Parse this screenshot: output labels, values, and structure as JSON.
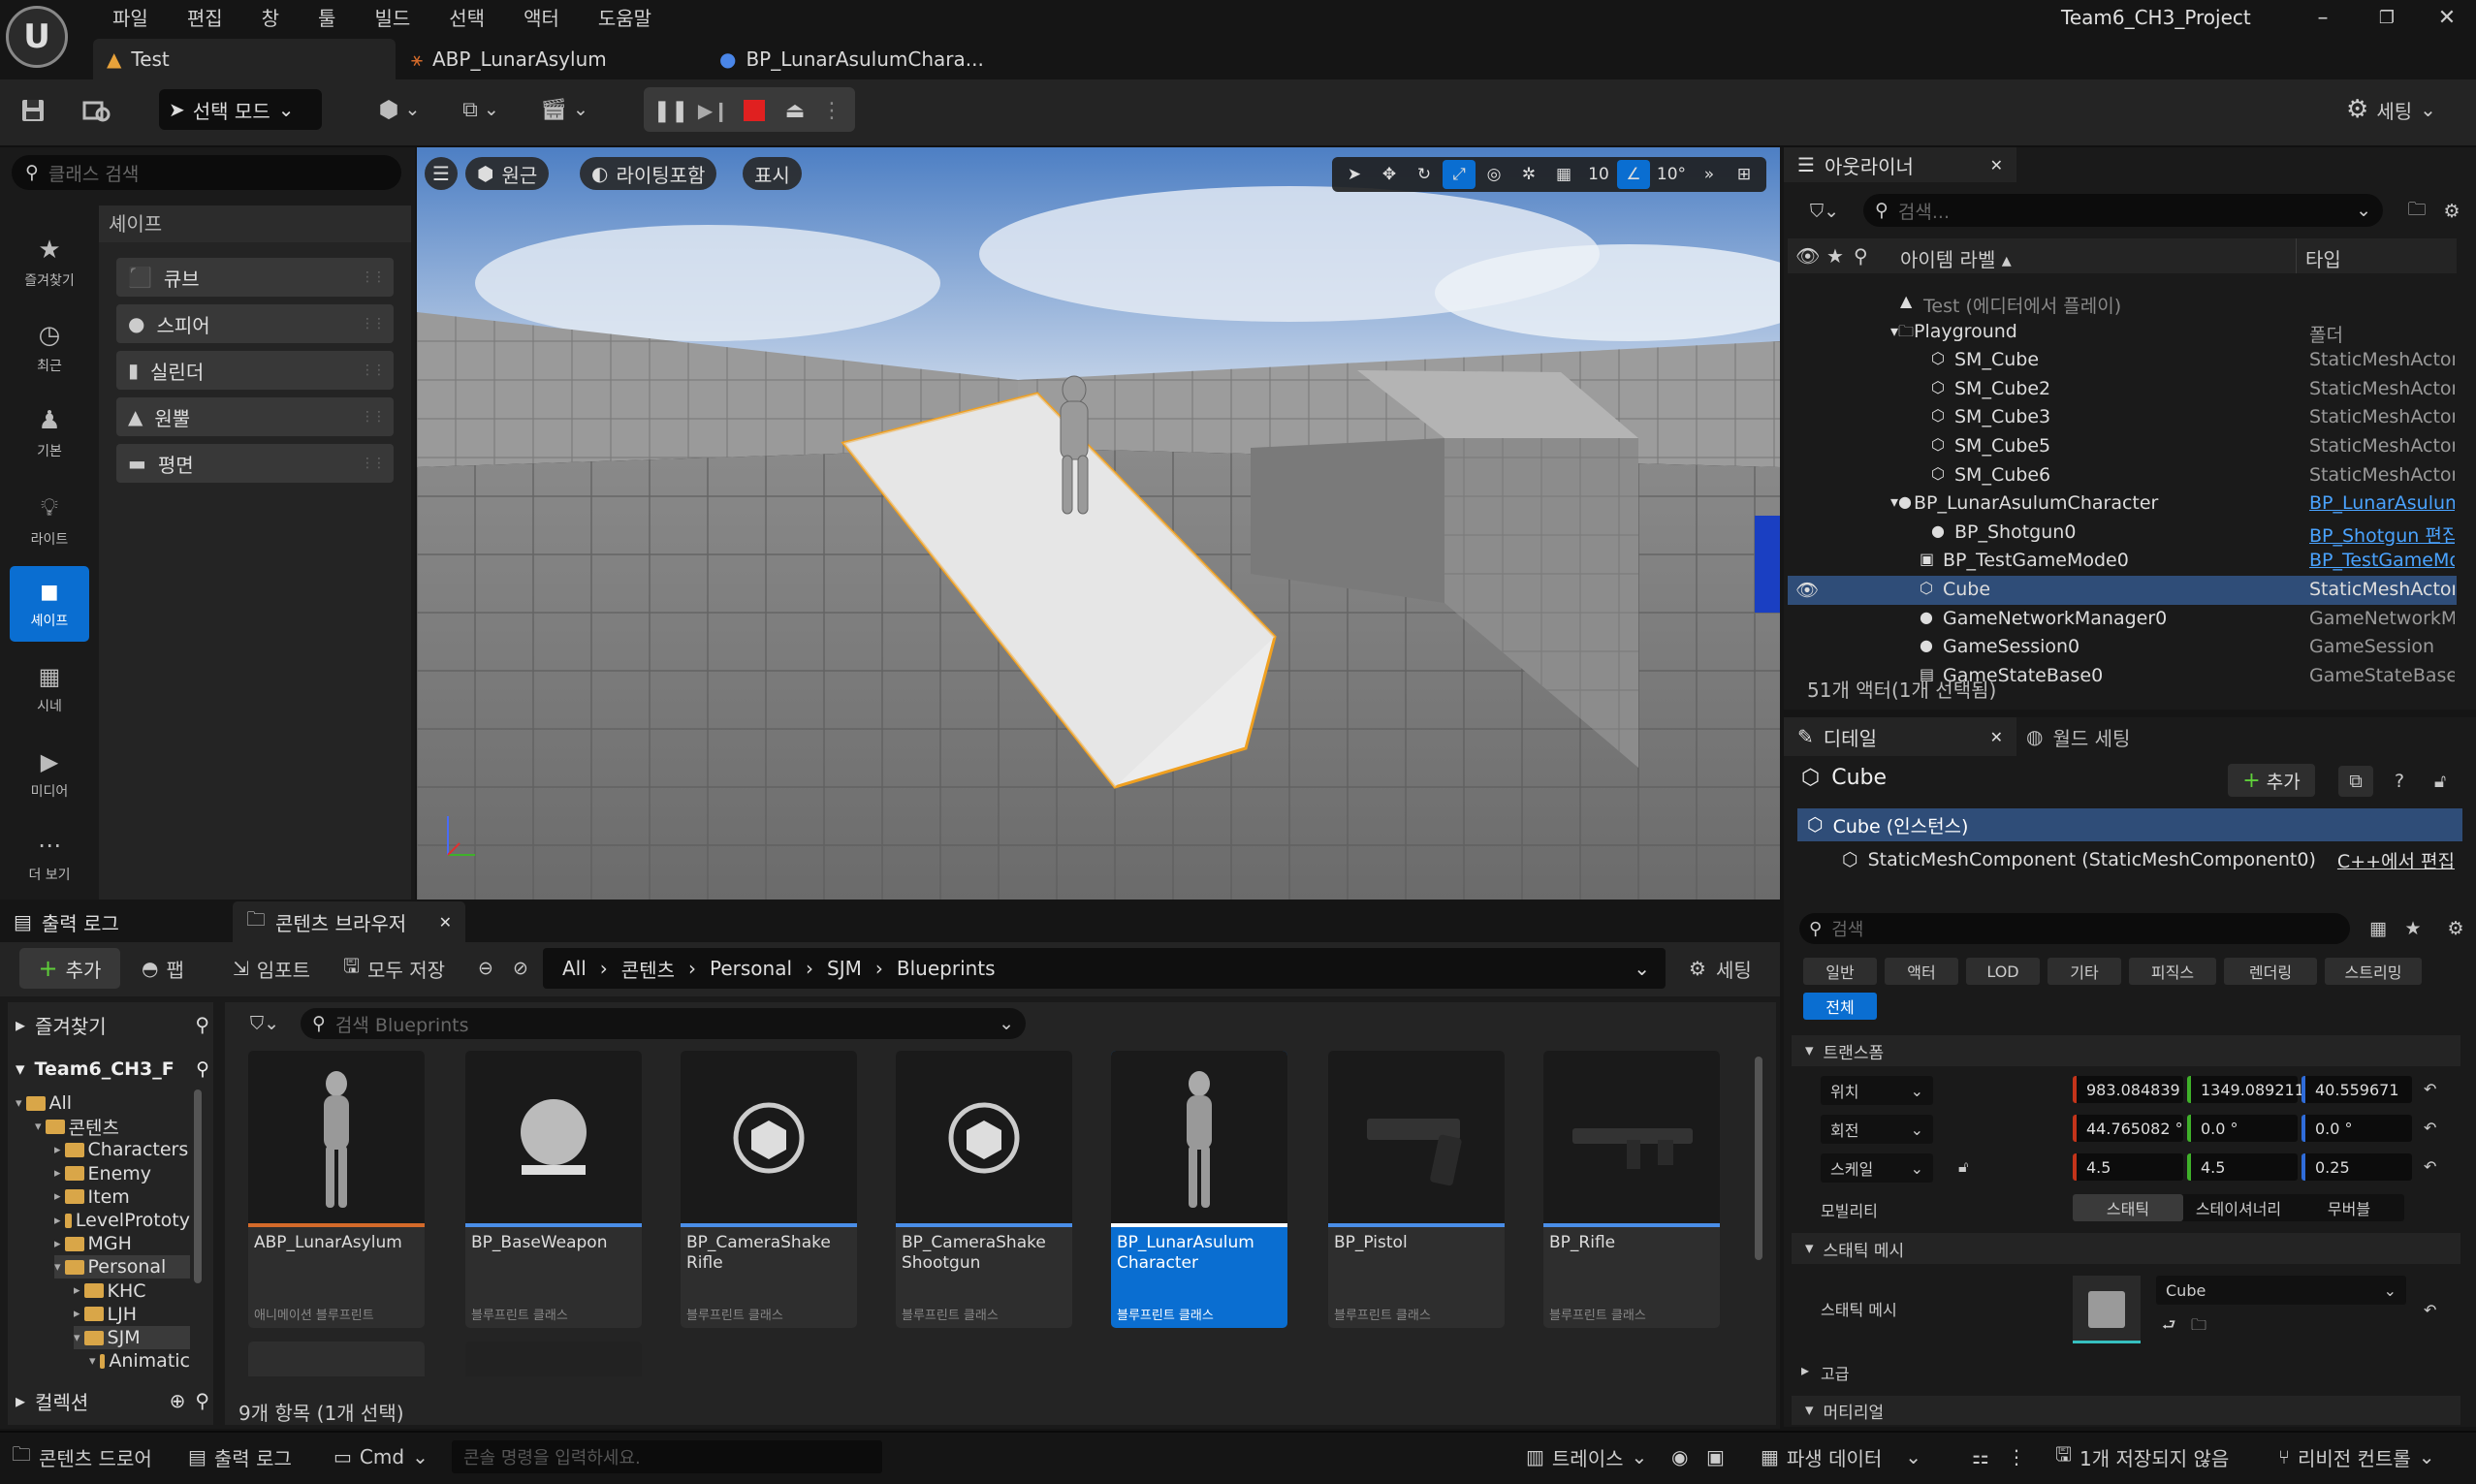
{
  "menu": [
    "파일",
    "편집",
    "창",
    "툴",
    "빌드",
    "선택",
    "액터",
    "도움말"
  ],
  "tabs": {
    "level": "Test",
    "anim": "ABP_LunarAsylum",
    "char": "BP_LunarAsulumChara..."
  },
  "project_title": "Team6_CH3_Project",
  "toolbar": {
    "mode": "선택 모드",
    "settings": "세팅"
  },
  "place_actors": {
    "search_placeholder": "클래스 검색",
    "categories": [
      "즐겨찾기",
      "최근",
      "기본",
      "라이트",
      "셰이프",
      "시네",
      "미디어",
      "더 보기"
    ],
    "active_category": "셰이프",
    "header": "셰이프",
    "shapes": [
      "큐브",
      "스피어",
      "실린더",
      "원뿔",
      "평면"
    ]
  },
  "viewport": {
    "view_mode": "원근",
    "lighting": "라이팅포함",
    "show": "표시",
    "grid_snap": "10",
    "rot_snap": "10°"
  },
  "outliner": {
    "title": "아웃라이너",
    "search_placeholder": "검색...",
    "col_label": "아이템 라벨 ▴",
    "col_type": "타입",
    "rows": [
      {
        "name": "Test (에디터에서 플레이)",
        "type": ""
      },
      {
        "name": "Playground",
        "type": "폴더"
      },
      {
        "name": "SM_Cube",
        "type": "StaticMeshActor"
      },
      {
        "name": "SM_Cube2",
        "type": "StaticMeshActor"
      },
      {
        "name": "SM_Cube3",
        "type": "StaticMeshActor"
      },
      {
        "name": "SM_Cube5",
        "type": "StaticMeshActor"
      },
      {
        "name": "SM_Cube6",
        "type": "StaticMeshActor"
      },
      {
        "name": "BP_LunarAsulumCharacter",
        "type": "BP_LunarAsulum"
      },
      {
        "name": "BP_Shotgun0",
        "type": "BP_Shotgun 편집"
      },
      {
        "name": "BP_TestGameMode0",
        "type": "BP_TestGameMo"
      },
      {
        "name": "Cube",
        "type": "StaticMeshActor"
      },
      {
        "name": "GameNetworkManager0",
        "type": "GameNetworkMa"
      },
      {
        "name": "GameSession0",
        "type": "GameSession"
      },
      {
        "name": "GameStateBase0",
        "type": "GameStateBase"
      }
    ],
    "status": "51개 액터(1개 선택됨)"
  },
  "details": {
    "title": "디테일",
    "world_tab": "월드 세팅",
    "actor_name": "Cube",
    "add_label": "추가",
    "instance": "Cube (인스턴스)",
    "component": "StaticMeshComponent (StaticMeshComponent0)",
    "cpp_edit": "C++에서 편집",
    "search_placeholder": "검색",
    "filters": [
      "일반",
      "액터",
      "LOD",
      "기타",
      "피직스",
      "렌더링",
      "스트리밍"
    ],
    "filter_all": "전체",
    "transform_header": "트랜스폼",
    "location": {
      "label": "위치",
      "x": "983.084839",
      "y": "1349.089211",
      "z": "40.559671"
    },
    "rotation": {
      "label": "회전",
      "x": "44.765082 °",
      "y": "0.0 °",
      "z": "0.0 °"
    },
    "scale": {
      "label": "스케일",
      "x": "4.5",
      "y": "4.5",
      "z": "0.25"
    },
    "mobility": {
      "label": "모빌리티",
      "options": [
        "스태틱",
        "스테이셔너리",
        "무버블"
      ]
    },
    "static_mesh_header": "스태틱 메시",
    "static_mesh_label": "스태틱 메시",
    "static_mesh_value": "Cube",
    "advanced": "고급",
    "materials_header": "머티리얼"
  },
  "content_browser": {
    "output_tab": "출력 로그",
    "cb_tab": "콘텐츠 브라우저",
    "add": "추가",
    "fab": "팹",
    "import": "임포트",
    "save_all": "모두 저장",
    "path": [
      "All",
      "콘텐츠",
      "Personal",
      "SJM",
      "Blueprints"
    ],
    "settings": "세팅",
    "favorites": "즐겨찾기",
    "project": "Team6_CH3_F",
    "tree": [
      "All",
      "콘텐츠",
      "Characters",
      "Enemy",
      "Item",
      "LevelPrototy",
      "MGH",
      "Personal",
      "KHC",
      "LJH",
      "SJM",
      "Animatic"
    ],
    "collections": "컬렉션",
    "search_placeholder": "검색 Blueprints",
    "assets": [
      {
        "name": "ABP_LunarAsylum",
        "type": "애니메이션 블루프린트"
      },
      {
        "name": "BP_BaseWeapon",
        "type": "블루프린트 클래스"
      },
      {
        "name": "BP_CameraShake Rifle",
        "type": "블루프린트 클래스"
      },
      {
        "name": "BP_CameraShake Shootgun",
        "type": "블루프린트 클래스"
      },
      {
        "name": "BP_LunarAsulum Character",
        "type": "블루프린트 클래스"
      },
      {
        "name": "BP_Pistol",
        "type": "블루프린트 클래스"
      },
      {
        "name": "BP_Rifle",
        "type": "블루프린트 클래스"
      }
    ],
    "item_count": "9개 항목 (1개 선택)"
  },
  "statusbar": {
    "drawer": "콘텐츠 드로어",
    "output": "출력 로그",
    "cmd": "Cmd",
    "cmd_placeholder": "콘솔 명령을 입력하세요.",
    "trace": "트레이스",
    "derived": "파생 데이터",
    "unsaved": "1개 저장되지 않음",
    "revision": "리비전 컨트롤"
  }
}
